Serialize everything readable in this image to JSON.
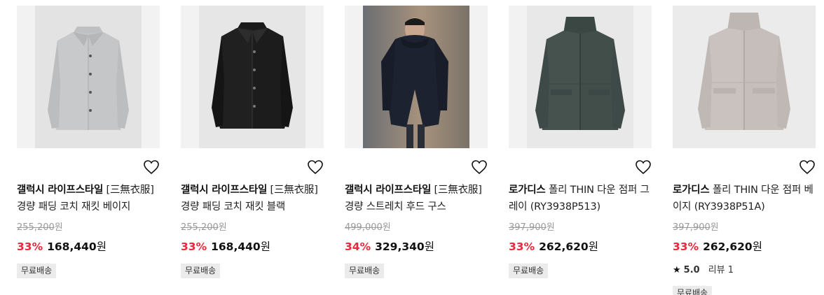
{
  "products": [
    {
      "brand": "갤럭시 라이프스타일",
      "title": "[三無衣服] 경량 패딩 코치 재킷 베이지",
      "original_price": "255,200",
      "discount": "33%",
      "sale_price": "168,440",
      "currency": "원",
      "badge": "무료배송",
      "image": "light-gray-coach-jacket"
    },
    {
      "brand": "갤럭시 라이프스타일",
      "title": "[三無衣服] 경량 패딩 코치 재킷 블랙",
      "original_price": "255,200",
      "discount": "33%",
      "sale_price": "168,440",
      "currency": "원",
      "badge": "무료배송",
      "image": "black-coach-jacket"
    },
    {
      "brand": "갤럭시 라이프스타일",
      "title": "[三無衣服] 경량 스트레치 후드 구스",
      "original_price": "499,000",
      "discount": "34%",
      "sale_price": "329,340",
      "currency": "원",
      "badge": "무료배송",
      "image": "model-in-navy-hooded-down"
    },
    {
      "brand": "로가디스",
      "title": "폴리 THIN 다운 점퍼 그레이 (RY3938P513)",
      "original_price": "397,900",
      "discount": "33%",
      "sale_price": "262,620",
      "currency": "원",
      "badge": "무료배송",
      "image": "dark-gray-down-jumper"
    },
    {
      "brand": "로가디스",
      "title": "폴리 THIN 다운 점퍼 베이지 (RY3938P51A)",
      "original_price": "397,900",
      "discount": "33%",
      "sale_price": "262,620",
      "currency": "원",
      "rating": "5.0",
      "reviews": "리뷰 1",
      "badge": "무료배송",
      "image": "beige-down-jumper"
    }
  ],
  "icons": {
    "wishlist": "heart-outline-icon",
    "rating": "star-icon"
  },
  "colors": {
    "discount": "#f0273b",
    "badge_bg": "#ebebeb",
    "original_price": "#9a9a9a"
  }
}
